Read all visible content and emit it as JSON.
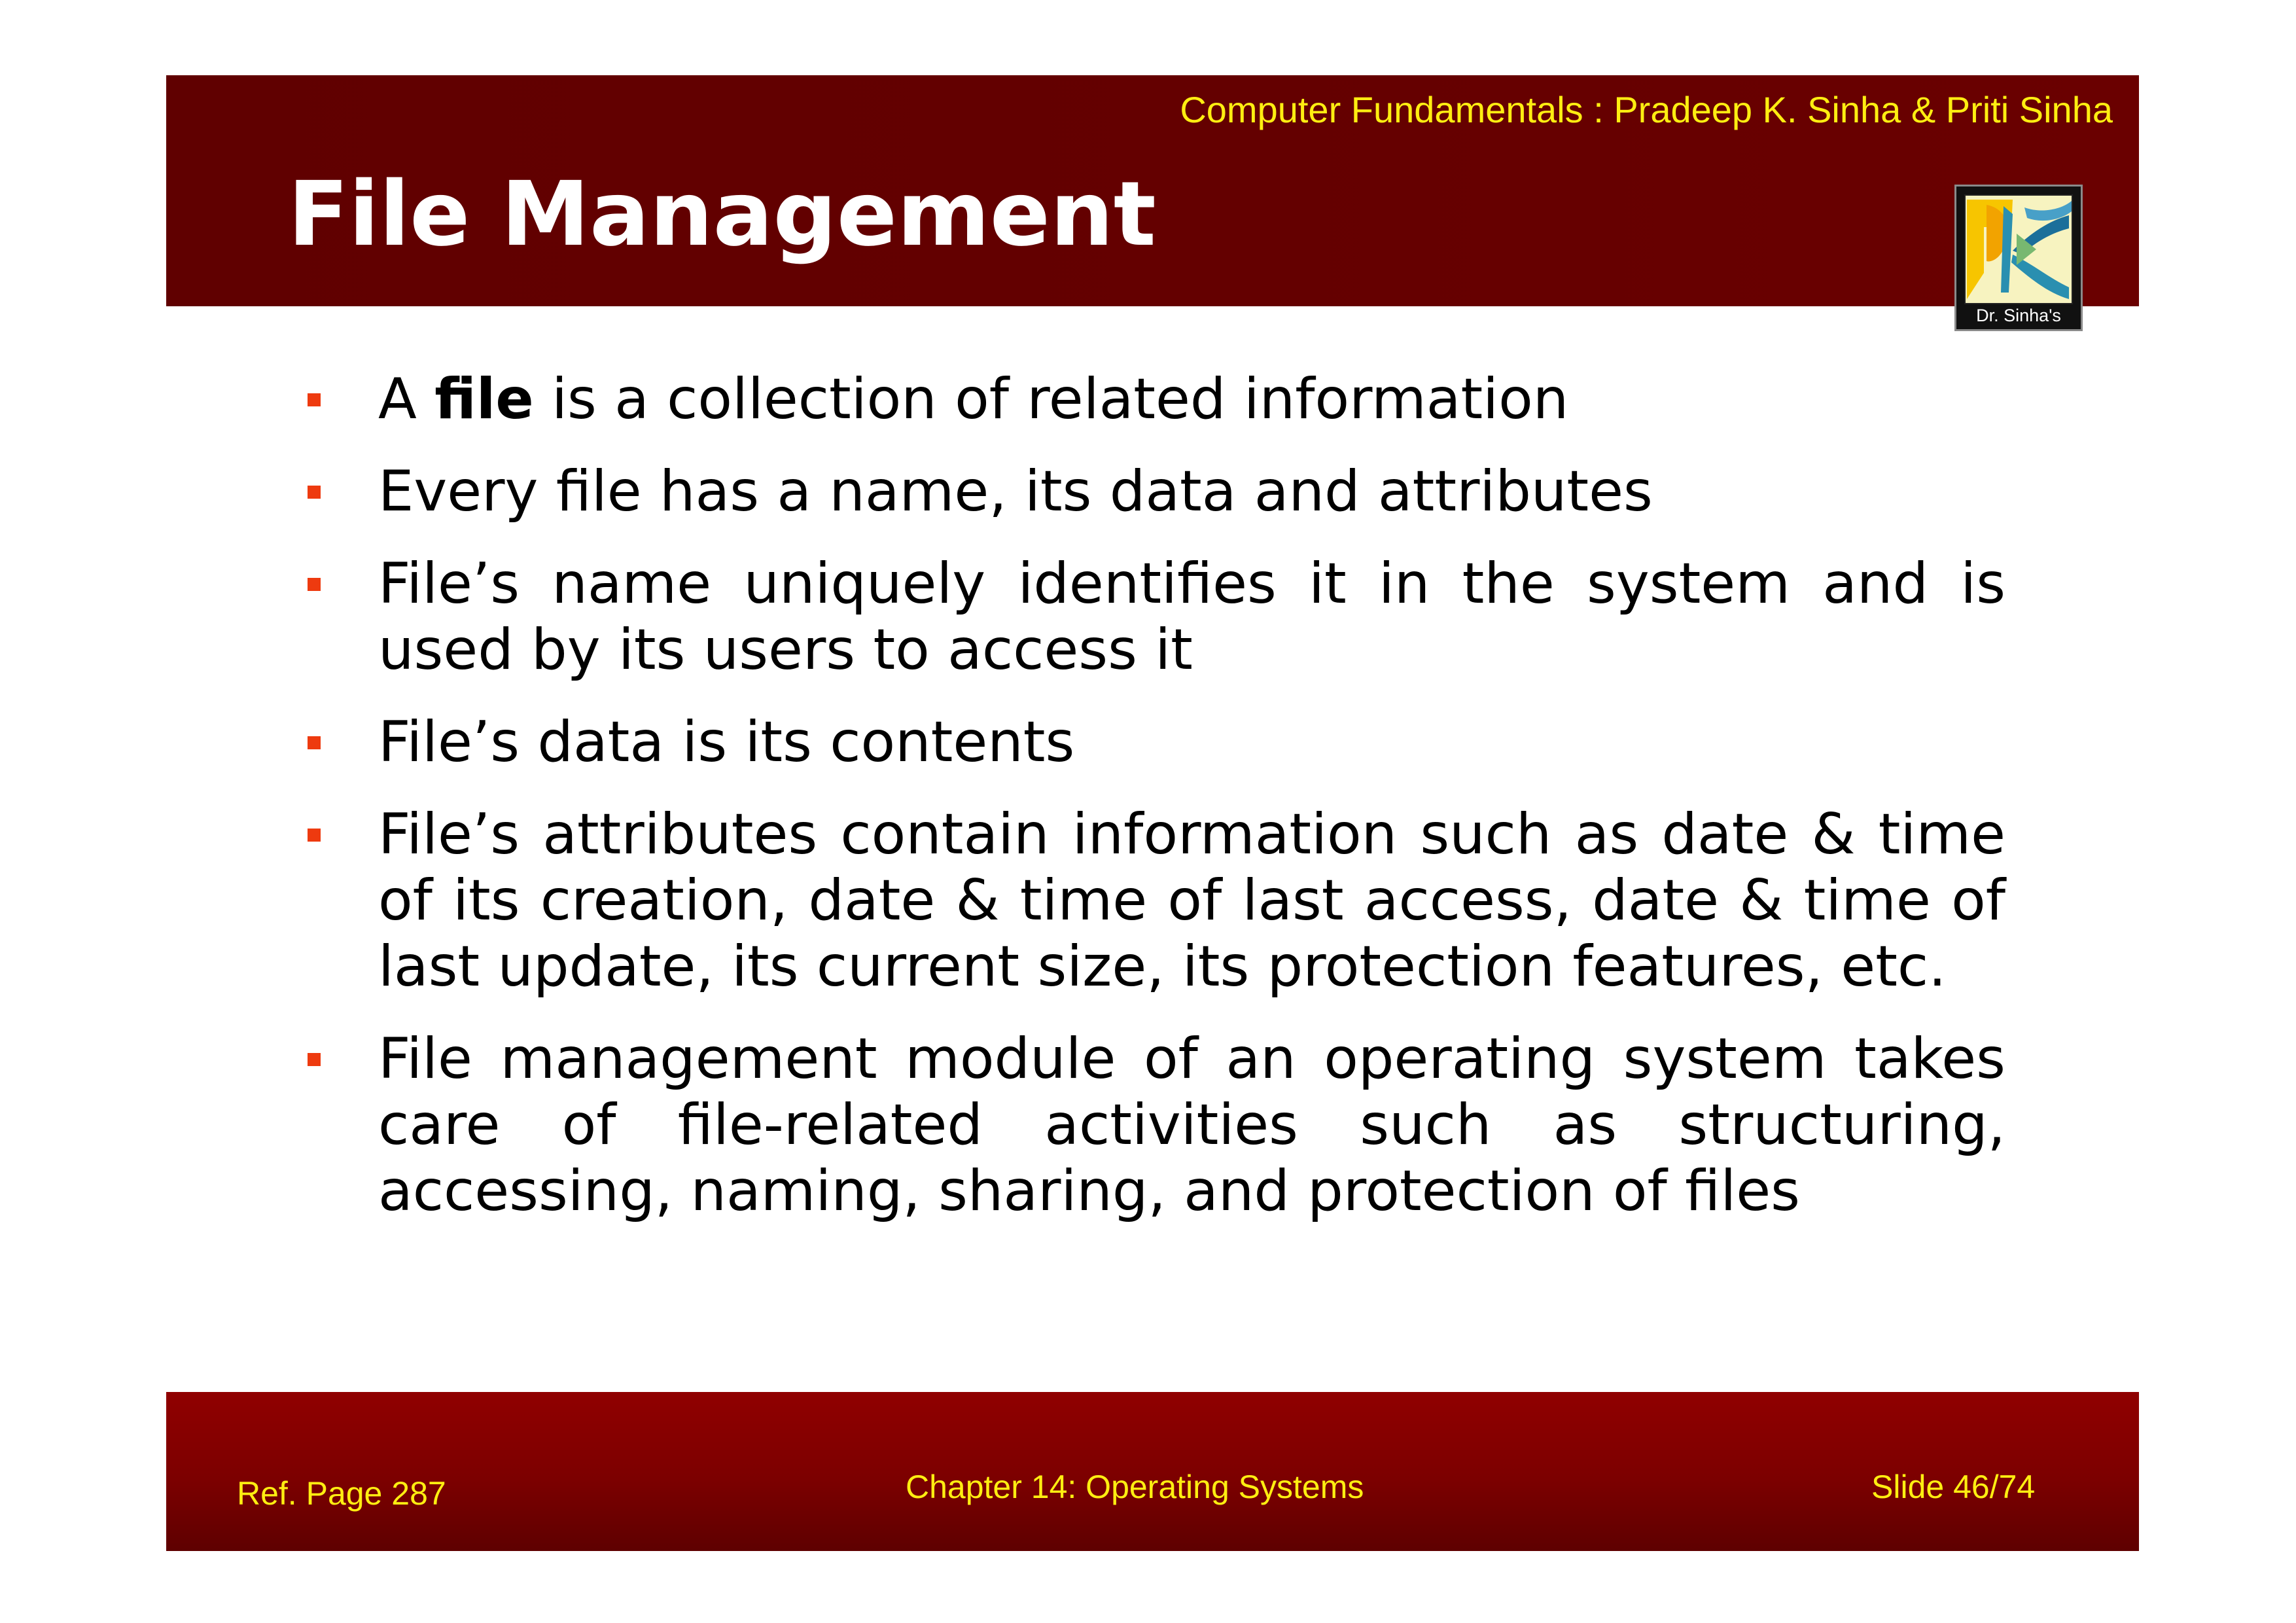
{
  "header": {
    "source": "Computer Fundamentals : Pradeep K. Sinha & Priti Sinha",
    "title": "File Management",
    "logo_caption": "Dr. Sinha's"
  },
  "bullets": [
    {
      "before": "A ",
      "bold": "file",
      "after": " is a collection of related information"
    },
    {
      "text": "Every file has a name, its data and attributes"
    },
    {
      "text": "File’s name uniquely identifies it in the system and is used by its users to access it"
    },
    {
      "text": "File’s data is its contents"
    },
    {
      "text": "File’s attributes contain information such as date & time of its creation, date & time of last access, date & time of last update, its current size, its protection features, etc."
    },
    {
      "text": "File management module of an operating system takes care of file-related activities such as structuring, accessing, naming, sharing, and protection of files"
    }
  ],
  "footer": {
    "ref_page": "Ref. Page  287",
    "chapter": "Chapter 14: Operating Systems",
    "slide": "Slide 46/74"
  },
  "colors": {
    "header_band": "#640000",
    "footer_band": "#860000",
    "accent_text": "#ffee11",
    "bullet": "#ee3a0f",
    "title": "#ffffff"
  },
  "icons": {
    "logo": "dr-sinhas-logo-icon",
    "bullet": "square-bullet-icon"
  }
}
